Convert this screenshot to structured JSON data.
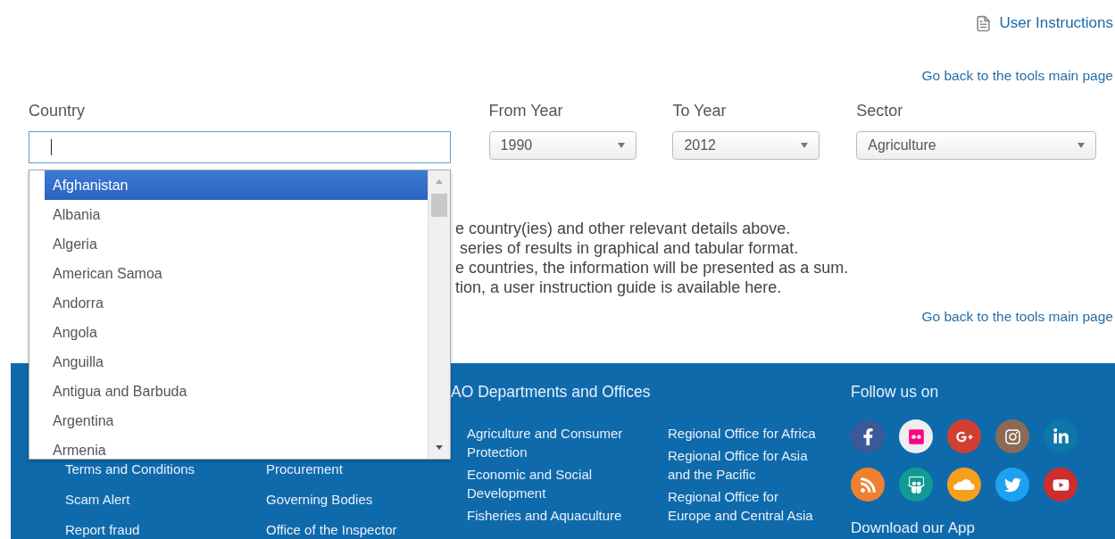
{
  "header": {
    "instructions_link": "User Instructions",
    "back_link": "Go back to the tools main page"
  },
  "filters": {
    "country": {
      "label": "Country",
      "focused": true
    },
    "selects": [
      {
        "label": "From Year",
        "value": "1990"
      },
      {
        "label": "To Year",
        "value": "2012"
      },
      {
        "label": "Sector",
        "value": "Agriculture"
      }
    ]
  },
  "country_dropdown": [
    {
      "label": "Afghanistan",
      "selected": true
    },
    {
      "label": "Albania",
      "selected": false
    },
    {
      "label": "Algeria",
      "selected": false
    },
    {
      "label": "American Samoa",
      "selected": false
    },
    {
      "label": "Andorra",
      "selected": false
    },
    {
      "label": "Angola",
      "selected": false
    },
    {
      "label": "Anguilla",
      "selected": false
    },
    {
      "label": "Antigua and Barbuda",
      "selected": false
    },
    {
      "label": "Argentina",
      "selected": false
    },
    {
      "label": "Armenia",
      "selected": false
    }
  ],
  "intro_lines": [
    "e country(ies) and other relevant details above.",
    " series of results in graphical and tabular format.",
    "e countries, the information will be presented as a sum.",
    "tion, a user instruction guide is available here."
  ],
  "back_link_bottom": "Go back to the tools main page",
  "footer": {
    "column_1": [
      "Terms and Conditions",
      "Scam Alert",
      "Report fraud"
    ],
    "column_2": [
      "Procurement",
      "Governing Bodies",
      "Office of the Inspector"
    ],
    "departments": {
      "title": "AO Departments and Offices",
      "column_1": [
        "Agriculture and Consumer Protection",
        "Economic and Social Development",
        "Fisheries and Aquaculture"
      ],
      "column_2": [
        "Regional Office for Africa",
        "Regional Office for Asia and the Pacific",
        "Regional Office for Europe and Central Asia"
      ]
    },
    "follow_title": "Follow us on",
    "app_title": "Download our App"
  }
}
